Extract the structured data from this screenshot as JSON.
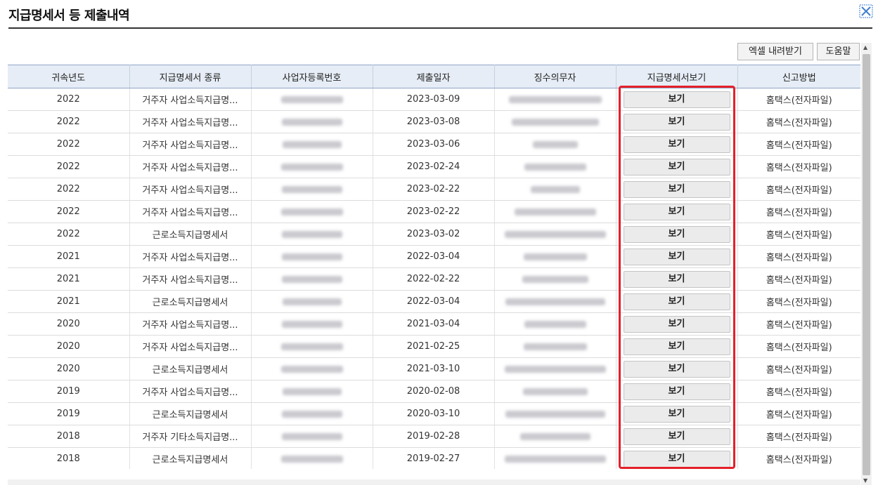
{
  "window": {
    "title": "지급명세서 등 제출내역"
  },
  "toolbar": {
    "excel_label": "엑셀 내려받기",
    "help_label": "도움말"
  },
  "table": {
    "headers": [
      "귀속년도",
      "지급명세서 종류",
      "사업자등록번호",
      "제출일자",
      "징수의무자",
      "지급명세서보기",
      "신고방법"
    ],
    "view_label": "보기",
    "rows": [
      {
        "year": "2022",
        "type": "거주자 사업소득지급명...",
        "date": "2023-03-09",
        "method": "홈택스(전자파일)"
      },
      {
        "year": "2022",
        "type": "거주자 사업소득지급명...",
        "date": "2023-03-08",
        "method": "홈택스(전자파일)"
      },
      {
        "year": "2022",
        "type": "거주자 사업소득지급명...",
        "date": "2023-03-06",
        "method": "홈택스(전자파일)"
      },
      {
        "year": "2022",
        "type": "거주자 사업소득지급명...",
        "date": "2023-02-24",
        "method": "홈택스(전자파일)"
      },
      {
        "year": "2022",
        "type": "거주자 사업소득지급명...",
        "date": "2023-02-22",
        "method": "홈택스(전자파일)"
      },
      {
        "year": "2022",
        "type": "거주자 사업소득지급명...",
        "date": "2023-02-22",
        "method": "홈택스(전자파일)"
      },
      {
        "year": "2022",
        "type": "근로소득지급명세서",
        "date": "2023-03-02",
        "method": "홈택스(전자파일)"
      },
      {
        "year": "2021",
        "type": "거주자 사업소득지급명...",
        "date": "2022-03-04",
        "method": "홈택스(전자파일)"
      },
      {
        "year": "2021",
        "type": "거주자 사업소득지급명...",
        "date": "2022-02-22",
        "method": "홈택스(전자파일)"
      },
      {
        "year": "2021",
        "type": "근로소득지급명세서",
        "date": "2022-03-04",
        "method": "홈택스(전자파일)"
      },
      {
        "year": "2020",
        "type": "거주자 사업소득지급명...",
        "date": "2021-03-04",
        "method": "홈택스(전자파일)"
      },
      {
        "year": "2020",
        "type": "거주자 사업소득지급명...",
        "date": "2021-02-25",
        "method": "홈택스(전자파일)"
      },
      {
        "year": "2020",
        "type": "근로소득지급명세서",
        "date": "2021-03-10",
        "method": "홈택스(전자파일)"
      },
      {
        "year": "2019",
        "type": "거주자 사업소득지급명...",
        "date": "2020-02-08",
        "method": "홈택스(전자파일)"
      },
      {
        "year": "2019",
        "type": "근로소득지급명세서",
        "date": "2020-03-10",
        "method": "홈택스(전자파일)"
      },
      {
        "year": "2018",
        "type": "거주자 기타소득지급명...",
        "date": "2019-02-28",
        "method": "홈택스(전자파일)"
      },
      {
        "year": "2018",
        "type": "근로소득지급명세서",
        "date": "2019-02-27",
        "method": "홈택스(전자파일)"
      }
    ]
  },
  "colors": {
    "highlight": "#e5202a",
    "header_bg": "#e6edf6",
    "redacted": "#c9c9cf"
  },
  "icons": {
    "close": "close-x-icon"
  }
}
